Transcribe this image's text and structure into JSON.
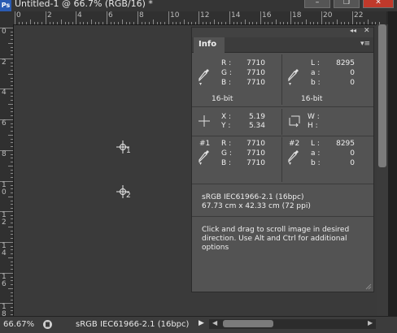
{
  "window": {
    "title": "Untitled-1 @ 66.7% (RGB/16) *",
    "app_icon": "Ps",
    "buttons": [
      "minimize",
      "restore",
      "close"
    ]
  },
  "rulers": {
    "horizontal_labels": [
      "0",
      "2",
      "4",
      "6",
      "8",
      "10",
      "12",
      "14",
      "16",
      "18",
      "20",
      "22"
    ],
    "vertical_labels": [
      "0",
      "2",
      "4",
      "6",
      "8",
      "10",
      "12",
      "14",
      "16",
      "18"
    ]
  },
  "samplers": [
    {
      "label": "1"
    },
    {
      "label": "2"
    }
  ],
  "info_panel": {
    "tab": "Info",
    "rgb": {
      "r_label": "R :",
      "g_label": "G :",
      "b_label": "B :",
      "r": "7710",
      "g": "7710",
      "b": "7710"
    },
    "lab": {
      "l_label": "L :",
      "a_label": "a :",
      "b_label": "b :",
      "l": "8295",
      "a": "0",
      "b": "0"
    },
    "bit_left": "16-bit",
    "bit_right": "16-bit",
    "xy": {
      "x_label": "X :",
      "y_label": "Y :",
      "x": "5.19",
      "y": "5.34"
    },
    "wh": {
      "w_label": "W :",
      "h_label": "H :"
    },
    "sampler1": {
      "label": "#1",
      "r_label": "R :",
      "g_label": "G :",
      "b_label": "B :",
      "r": "7710",
      "g": "7710",
      "b": "7710"
    },
    "sampler2": {
      "label": "#2",
      "l_label": "L :",
      "a_label": "a :",
      "b_label": "b :",
      "l": "8295",
      "a": "0",
      "b": "0"
    },
    "doc_profile": "sRGB IEC61966-2.1 (16bpc)",
    "doc_size": "67.73 cm x 42.33 cm (72 ppi)",
    "hint": "Click and drag to scroll image in desired direction.  Use Alt and Ctrl for additional options"
  },
  "status": {
    "zoom": "66.67%",
    "doc_profile": "sRGB IEC61966-2.1 (16bpc)"
  },
  "colors": {
    "canvas": "#3a3a3a",
    "panel": "#535353",
    "app_icon": "#2a5bb3"
  }
}
